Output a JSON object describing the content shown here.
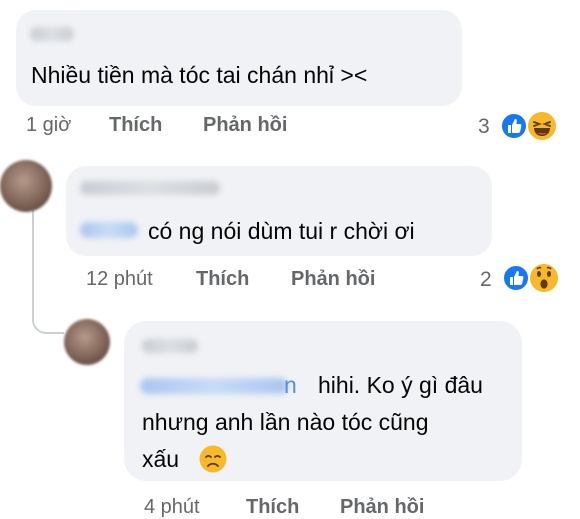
{
  "comments": [
    {
      "text": "Nhiều tiền mà tóc tai chán nhỉ ><",
      "time": "1 giờ",
      "like_label": "Thích",
      "reply_label": "Phản hồi",
      "reaction_count": "3",
      "reactions": [
        "like-icon",
        "haha-icon"
      ]
    },
    {
      "text": "có ng nói dùm tui r chời ơi",
      "time": "12 phút",
      "like_label": "Thích",
      "reply_label": "Phản hồi",
      "reaction_count": "2",
      "reactions": [
        "like-icon",
        "wow-icon"
      ]
    },
    {
      "tag_suffix": "n",
      "text_line1": "hihi. Ko ý gì đâu",
      "text_line2": "nhưng anh lần nào tóc cũng",
      "text_line3": "xấu",
      "time": "4 phút",
      "like_label": "Thích",
      "reply_label": "Phản hồi",
      "reactions": [
        "sad-face-emoji"
      ]
    }
  ],
  "colors": {
    "bubble": "#f0f2f5",
    "meta": "#65676b",
    "like_blue": "#1877f2",
    "emoji_yellow": "#f7b928"
  }
}
